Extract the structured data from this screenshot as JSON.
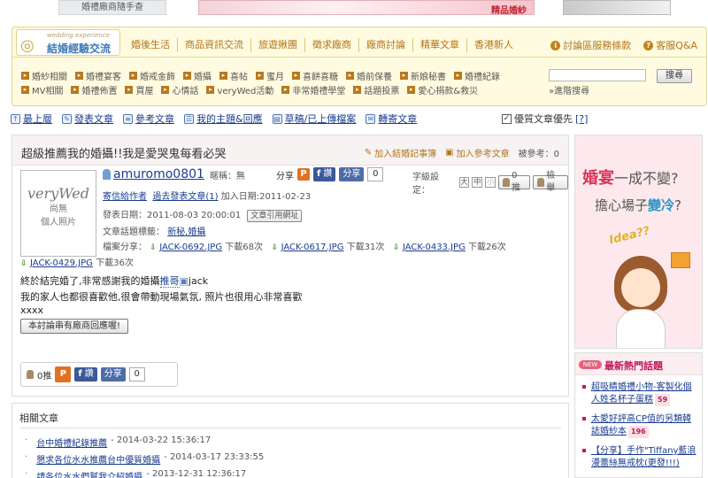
{
  "banner": {
    "ad1_text": "婚禮廠商隨手查",
    "ad2_text": "精品婚紗"
  },
  "nav": {
    "logo_sub": "wedding experience",
    "logo_name": "結婚經驗交流",
    "tabs": [
      "婚後生活",
      "商品資訊交流",
      "旅遊揪團",
      "徵求廠商",
      "廠商討論",
      "精華文章",
      "香港新人"
    ],
    "right_links": [
      {
        "icon": "info-icon",
        "label": "討論區服務條款"
      },
      {
        "icon": "help-icon",
        "label": "客服Q&A"
      }
    ],
    "sub_row1": [
      "婚紗相關",
      "婚禮宴客",
      "婚戒金飾",
      "婚攝",
      "喜帖",
      "蜜月",
      "喜餅喜糖",
      "婚前保養",
      "新娘秘書",
      "婚禮紀錄"
    ],
    "sub_row2": [
      "MV相關",
      "婚禮佈置",
      "買屋",
      "心情話",
      "veryWed活動",
      "非常婚禮學堂",
      "話題投票",
      "愛心捐款&救災"
    ],
    "search_button": "搜尋",
    "advanced_search": "»進階搜尋"
  },
  "toolbar": {
    "items": [
      {
        "icon": "up-icon",
        "label": "最上層"
      },
      {
        "icon": "post-icon",
        "label": "發表文章"
      },
      {
        "icon": "reference-icon",
        "label": "參考文章"
      },
      {
        "icon": "my-topics-icon",
        "label": "我的主題&回應"
      },
      {
        "icon": "draft-icon",
        "label": "草稿/已上傳檔案"
      },
      {
        "icon": "repost-icon",
        "label": "轉寄文章"
      }
    ],
    "quality_label": "優質文章優先",
    "quality_help": "[?]"
  },
  "post": {
    "title": "超級推薦我的婚攝!!我是愛哭鬼每看必哭",
    "add_diary": "加入結婚記事簿",
    "add_reference": "加入參考文章",
    "ref_count": "被參考：0",
    "avatar_logo": "veryWed",
    "avatar_note1": "尚無",
    "avatar_note2": "個人照片",
    "username": "amuromo0801",
    "nickname": "暱稱：無",
    "share_label": "分享",
    "fb_label": "讚",
    "share_btn": "分享",
    "share_count": "0",
    "font_label": "字級設定：",
    "font_sizes": [
      "大",
      "中",
      "小"
    ],
    "vote_label": "0推",
    "report_label": "檢舉",
    "send_msg": "寄信給作者",
    "past_posts": "過去發表文章(1)",
    "join_date": "加入日期:2011-02-23",
    "post_date": "發表日期：2011-08-03 20:00:01",
    "copy_url": "文章引用網址",
    "topic_tags_label": "文章話題標籤：",
    "topic_tags": "新秘,婚攝",
    "attach_label": "檔案分享：",
    "attachments": [
      {
        "name": "JACK-0692.JPG",
        "downloads": "下載68次"
      },
      {
        "name": "JACK-0617.JPG",
        "downloads": "下載31次"
      },
      {
        "name": "JACK-0433.JPG",
        "downloads": "下載26次"
      },
      {
        "name": "JACK-0429.JPG",
        "downloads": "下載36次"
      }
    ],
    "body_line1_pre": "終於結完婚了,非常感謝我的婚攝",
    "body_line1_link": "推哥",
    "body_line1_post": "jack",
    "body_line2": "我的家人也都很喜歡他,很會帶動現場氣氛, 照片也很用心非常喜歡",
    "body_line3": "xxxx",
    "reply_button": "本討論串有廠商回應喔!",
    "bottom_vote": "0推",
    "bottom_fb": "讚",
    "bottom_share": "分享",
    "bottom_count": "0"
  },
  "related": {
    "title": "相關文章",
    "items": [
      {
        "title": "台中婚禮紀錄推薦",
        "date": "- 2014-03-22 15:36:17"
      },
      {
        "title": "懇求各位水水推薦台中優質婚攝",
        "date": "- 2014-03-17 23:33:55"
      },
      {
        "title": "請各位水水們幫我介紹婚攝",
        "date": "- 2013-12-31 12:36:17"
      }
    ]
  },
  "ad": {
    "line1_red": "婚宴",
    "line1_rest": "一成不變?",
    "line2_pre": "擔心場子",
    "line2_blue": "變冷",
    "line2_end": "?",
    "idea": "Idea??"
  },
  "hot": {
    "badge": "NEW",
    "title": "最新熱門話題",
    "items": [
      {
        "text": "超吸睛婚禮小物-客製化個人姓名杯子蛋糕",
        "count": "59"
      },
      {
        "text": "太愛好評高CP值的另類韓誌婚紗本",
        "count": "196"
      },
      {
        "text": "【分享】手作\"Tiffany藍浪漫蕾絲無戒枕(更發!!!)",
        "count": ""
      }
    ]
  }
}
